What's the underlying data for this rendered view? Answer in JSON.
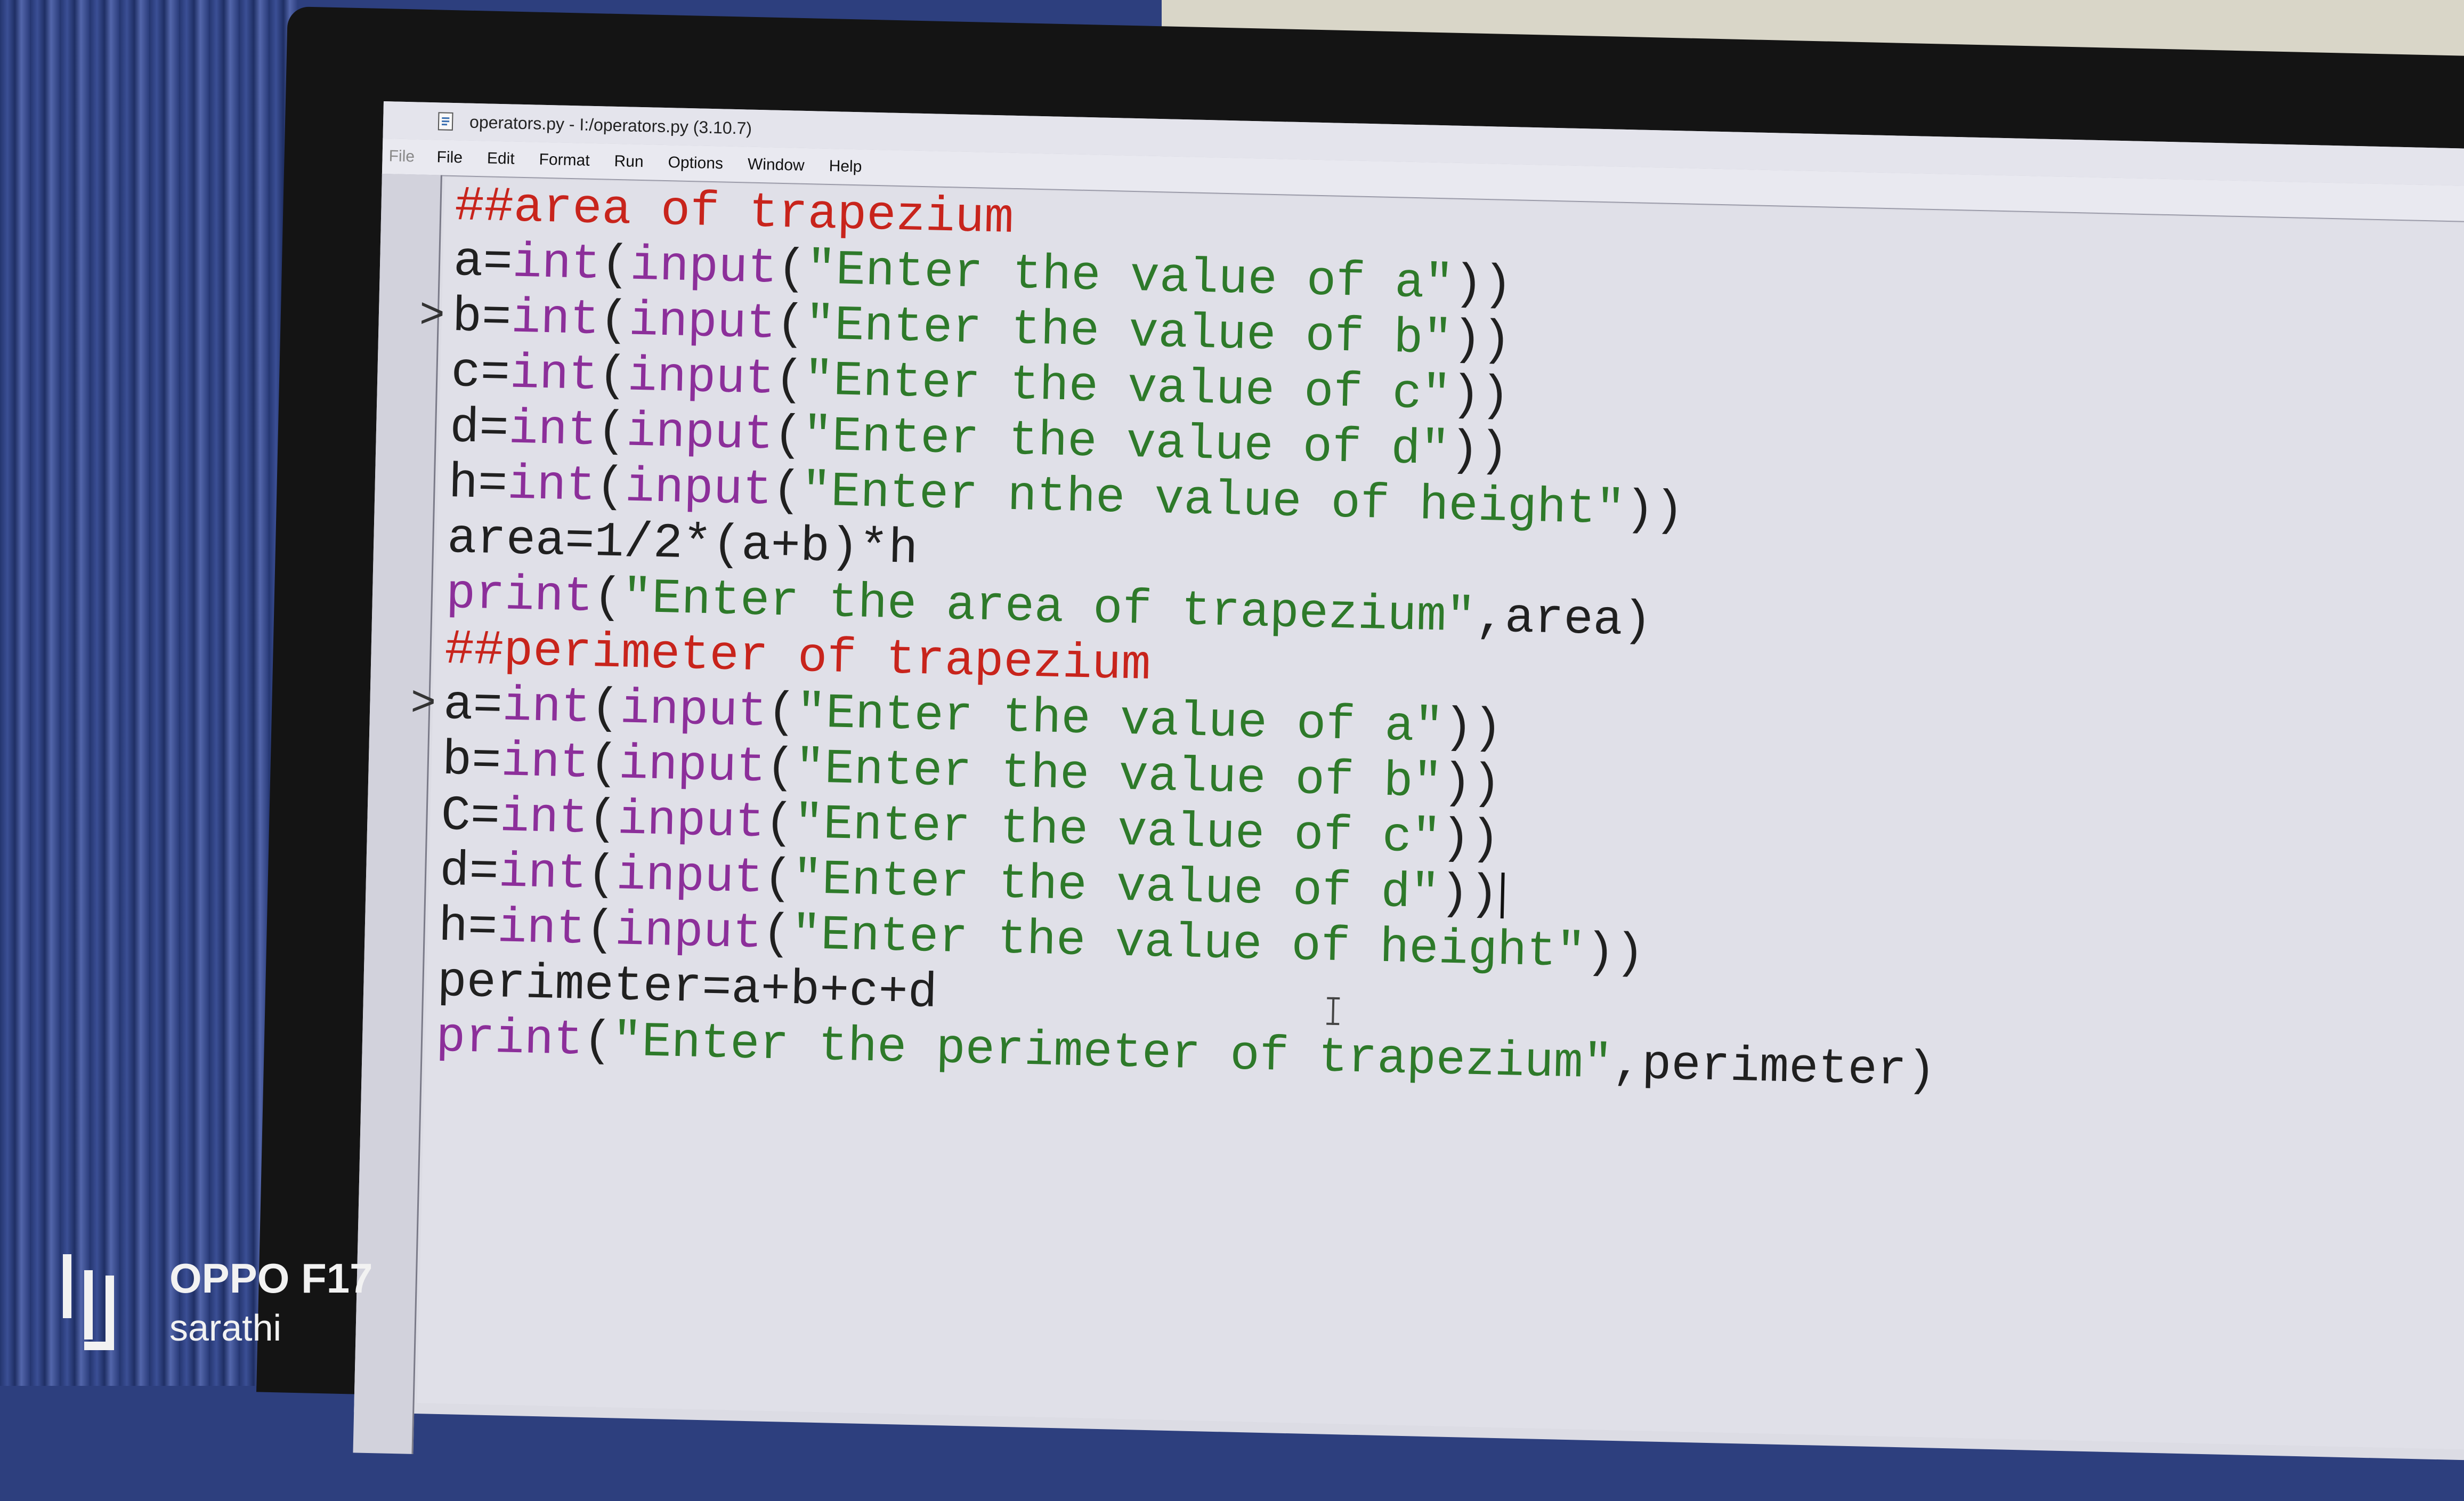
{
  "window": {
    "title": "operators.py - I:/operators.py (3.10.7)",
    "ghost_menu": "File"
  },
  "menu": [
    "File",
    "Edit",
    "Format",
    "Run",
    "Options",
    "Window",
    "Help"
  ],
  "code": [
    [
      {
        "t": "##area of trapezium",
        "c": "comment"
      }
    ],
    [
      {
        "t": "a=",
        "c": "plain"
      },
      {
        "t": "int",
        "c": "builtin"
      },
      {
        "t": "(",
        "c": "plain"
      },
      {
        "t": "input",
        "c": "builtin"
      },
      {
        "t": "(",
        "c": "plain"
      },
      {
        "t": "\"Enter the value of a\"",
        "c": "string"
      },
      {
        "t": "))",
        "c": "plain"
      }
    ],
    [
      {
        "t": "b=",
        "c": "plain"
      },
      {
        "t": "int",
        "c": "builtin"
      },
      {
        "t": "(",
        "c": "plain"
      },
      {
        "t": "input",
        "c": "builtin"
      },
      {
        "t": "(",
        "c": "plain"
      },
      {
        "t": "\"Enter the value of b\"",
        "c": "string"
      },
      {
        "t": "))",
        "c": "plain"
      }
    ],
    [
      {
        "t": "c=",
        "c": "plain"
      },
      {
        "t": "int",
        "c": "builtin"
      },
      {
        "t": "(",
        "c": "plain"
      },
      {
        "t": "input",
        "c": "builtin"
      },
      {
        "t": "(",
        "c": "plain"
      },
      {
        "t": "\"Enter the value of c\"",
        "c": "string"
      },
      {
        "t": "))",
        "c": "plain"
      }
    ],
    [
      {
        "t": "d=",
        "c": "plain"
      },
      {
        "t": "int",
        "c": "builtin"
      },
      {
        "t": "(",
        "c": "plain"
      },
      {
        "t": "input",
        "c": "builtin"
      },
      {
        "t": "(",
        "c": "plain"
      },
      {
        "t": "\"Enter the value of d\"",
        "c": "string"
      },
      {
        "t": "))",
        "c": "plain"
      }
    ],
    [
      {
        "t": "h=",
        "c": "plain"
      },
      {
        "t": "int",
        "c": "builtin"
      },
      {
        "t": "(",
        "c": "plain"
      },
      {
        "t": "input",
        "c": "builtin"
      },
      {
        "t": "(",
        "c": "plain"
      },
      {
        "t": "\"Enter nthe value of height\"",
        "c": "string"
      },
      {
        "t": "))",
        "c": "plain"
      }
    ],
    [
      {
        "t": "area=1/2*(a+b)*h",
        "c": "plain"
      }
    ],
    [
      {
        "t": "print",
        "c": "builtin"
      },
      {
        "t": "(",
        "c": "plain"
      },
      {
        "t": "\"Enter the area of trapezium\"",
        "c": "string"
      },
      {
        "t": ",area)",
        "c": "plain"
      }
    ],
    [
      {
        "t": "##perimeter of trapezium",
        "c": "comment"
      }
    ],
    [
      {
        "t": "a=",
        "c": "plain"
      },
      {
        "t": "int",
        "c": "builtin"
      },
      {
        "t": "(",
        "c": "plain"
      },
      {
        "t": "input",
        "c": "builtin"
      },
      {
        "t": "(",
        "c": "plain"
      },
      {
        "t": "\"Enter the value of a\"",
        "c": "string"
      },
      {
        "t": "))",
        "c": "plain"
      }
    ],
    [
      {
        "t": "b=",
        "c": "plain"
      },
      {
        "t": "int",
        "c": "builtin"
      },
      {
        "t": "(",
        "c": "plain"
      },
      {
        "t": "input",
        "c": "builtin"
      },
      {
        "t": "(",
        "c": "plain"
      },
      {
        "t": "\"Enter the value of b\"",
        "c": "string"
      },
      {
        "t": "))",
        "c": "plain"
      }
    ],
    [
      {
        "t": "C=",
        "c": "plain"
      },
      {
        "t": "int",
        "c": "builtin"
      },
      {
        "t": "(",
        "c": "plain"
      },
      {
        "t": "input",
        "c": "builtin"
      },
      {
        "t": "(",
        "c": "plain"
      },
      {
        "t": "\"Enter the value of c\"",
        "c": "string"
      },
      {
        "t": "))",
        "c": "plain"
      }
    ],
    [
      {
        "t": "d=",
        "c": "plain"
      },
      {
        "t": "int",
        "c": "builtin"
      },
      {
        "t": "(",
        "c": "plain"
      },
      {
        "t": "input",
        "c": "builtin"
      },
      {
        "t": "(",
        "c": "plain"
      },
      {
        "t": "\"Enter the value of d\"",
        "c": "string"
      },
      {
        "t": "))",
        "c": "plain"
      }
    ],
    [
      {
        "t": "h=",
        "c": "plain"
      },
      {
        "t": "int",
        "c": "builtin"
      },
      {
        "t": "(",
        "c": "plain"
      },
      {
        "t": "input",
        "c": "builtin"
      },
      {
        "t": "(",
        "c": "plain"
      },
      {
        "t": "\"Enter the value of height\"",
        "c": "string"
      },
      {
        "t": "))",
        "c": "plain"
      }
    ],
    [
      {
        "t": "perimeter=a+b+c+d",
        "c": "plain"
      }
    ],
    [
      {
        "t": "print",
        "c": "builtin"
      },
      {
        "t": "(",
        "c": "plain"
      },
      {
        "t": "\"Enter the perimeter of trapezium\"",
        "c": "string"
      },
      {
        "t": ",perimeter)",
        "c": "plain"
      }
    ]
  ],
  "prompt_marker": ">",
  "watermark": {
    "model": "OPPO F17",
    "owner": "sarathi"
  },
  "colors": {
    "comment": "#c8241c",
    "builtin": "#8c2f9a",
    "string": "#2e7a2a",
    "plain": "#202020"
  }
}
